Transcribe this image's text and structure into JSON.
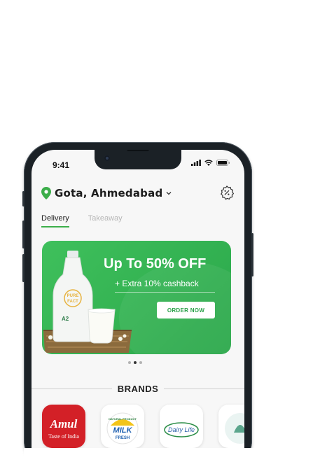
{
  "status_bar": {
    "time": "9:41"
  },
  "location": {
    "label": "Gota, Ahmedabad"
  },
  "tabs": [
    {
      "label": "Delivery",
      "active": true
    },
    {
      "label": "Takeaway",
      "active": false
    }
  ],
  "banner": {
    "headline": "Up To 50% OFF",
    "subline": "+ Extra 10% cashback",
    "cta_label": "ORDER NOW",
    "bottle_label_1": "PURE",
    "bottle_label_2": "FACT",
    "bottle_label_3": "A2",
    "background_color": "#34b554"
  },
  "carousel": {
    "slides": 3,
    "active_index": 1
  },
  "brands": {
    "title": "BRANDS",
    "items": [
      {
        "name": "Amul",
        "tagline": "Taste of India"
      },
      {
        "name": "Milk Fresh",
        "arc_text": "NATURAL PRODUCT",
        "main_text": "MILK",
        "sub_text": "FRESH"
      },
      {
        "name": "Dairy Life"
      },
      {
        "name": ""
      }
    ]
  },
  "colors": {
    "accent": "#3cae4a",
    "brand_red": "#d32027"
  }
}
